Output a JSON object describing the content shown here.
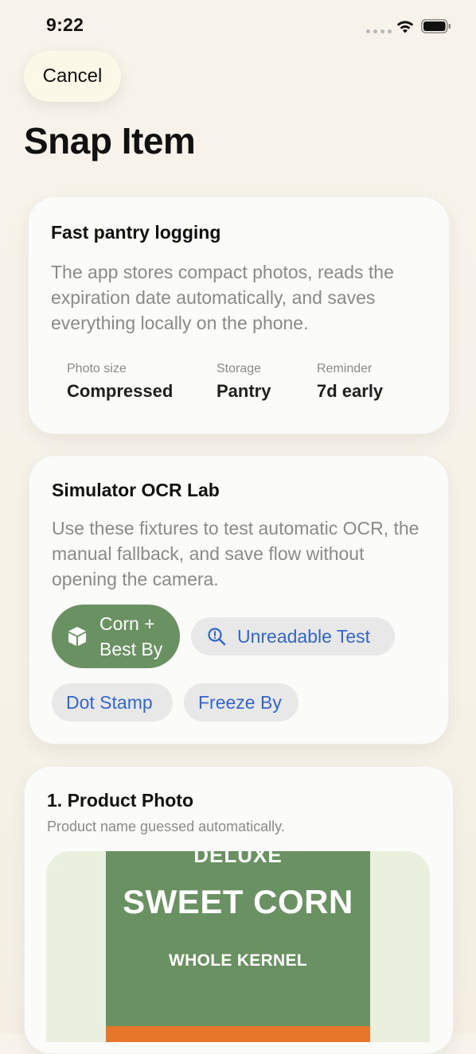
{
  "status_bar": {
    "time": "9:22"
  },
  "nav": {
    "cancel_label": "Cancel",
    "title": "Snap Item"
  },
  "info_card": {
    "title": "Fast pantry logging",
    "body": "The app stores compact photos, reads the expiration date automatically, and saves everything locally on the phone.",
    "stats": [
      {
        "label": "Photo size",
        "value": "Compressed"
      },
      {
        "label": "Storage",
        "value": "Pantry"
      },
      {
        "label": "Reminder",
        "value": "7d early"
      }
    ]
  },
  "ocr_lab": {
    "title": "Simulator OCR Lab",
    "body": "Use these fixtures to test automatic OCR, the manual fallback, and save flow without opening the camera.",
    "chips": [
      {
        "label_line1": "Corn +",
        "label_line2": "Best By",
        "icon": "box-icon",
        "selected": true
      },
      {
        "label": "Unreadable Test",
        "icon": "magnifier-icon",
        "selected": false
      },
      {
        "label": "Dot Stamp",
        "selected": false
      },
      {
        "label": "Freeze By",
        "selected": false
      }
    ]
  },
  "product_photo": {
    "title": "1. Product Photo",
    "subtitle": "Product name guessed automatically.",
    "label_top": "DELUXE",
    "label_main": "SWEET CORN",
    "label_sub": "WHOLE KERNEL"
  },
  "colors": {
    "accent_green": "#6a9162",
    "link_blue": "#3366cc",
    "background": "#f7f3ea",
    "stripe_orange": "#e7752a"
  }
}
